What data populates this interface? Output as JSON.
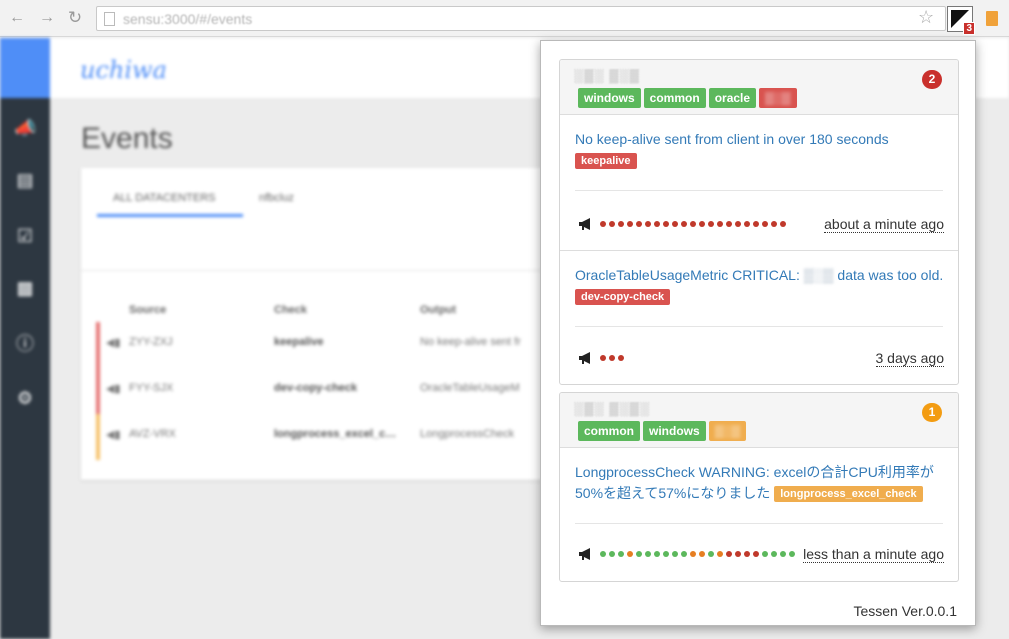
{
  "browser": {
    "url": "sensu:3000/#/events",
    "extension_badge": "3"
  },
  "app": {
    "logo": "uchiwa",
    "page_title": "Events",
    "tabs": [
      "ALL DATACENTERS",
      "nfbcluz"
    ],
    "columns": [
      "Source",
      "Check",
      "Output"
    ],
    "rows": [
      {
        "source": "ZYY-ZXJ",
        "check": "keepalive",
        "output": "No keep-alive sent fr",
        "status_color": "#e57373"
      },
      {
        "source": "FYY-SJX",
        "check": "dev-copy-check",
        "output": "OracleTableUsageM",
        "status_color": "#e57373"
      },
      {
        "source": "AVZ-VRX",
        "check": "longprocess_excel_c…",
        "output": "LongprocessCheck",
        "status_color": "#f6c26b"
      }
    ]
  },
  "popup": {
    "clients": [
      {
        "host": "░▒░ ▒░▒",
        "count": "2",
        "count_color": "#c9302c",
        "tags": [
          {
            "text": "windows",
            "color": "green"
          },
          {
            "text": "common",
            "color": "green"
          },
          {
            "text": "oracle",
            "color": "green"
          },
          {
            "text": "▒░▒",
            "color": "red",
            "blurred": true
          }
        ],
        "events": [
          {
            "output_parts": [
              "No keep-alive sent from client in over 180 seconds "
            ],
            "check": "keepalive",
            "check_color": "red",
            "history": [
              "#c0392b",
              "#c0392b",
              "#c0392b",
              "#c0392b",
              "#c0392b",
              "#c0392b",
              "#c0392b",
              "#c0392b",
              "#c0392b",
              "#c0392b",
              "#c0392b",
              "#c0392b",
              "#c0392b",
              "#c0392b",
              "#c0392b",
              "#c0392b",
              "#c0392b",
              "#c0392b",
              "#c0392b",
              "#c0392b",
              "#c0392b"
            ],
            "ago": "about a minute ago"
          },
          {
            "output_before": "OracleTableUsageMetric CRITICAL: ",
            "output_blur": "▒░▒",
            "output_after": " data was too old. ",
            "check": "dev-copy-check",
            "check_color": "red",
            "history": [
              "#c0392b",
              "#c0392b",
              "#c0392b"
            ],
            "ago": "3 days ago"
          }
        ]
      },
      {
        "host": "░▒░ ▒░▒░",
        "count": "1",
        "count_color": "#f39c12",
        "tags": [
          {
            "text": "common",
            "color": "green"
          },
          {
            "text": "windows",
            "color": "green"
          },
          {
            "text": "▒░▒",
            "color": "orange",
            "blurred": true
          }
        ],
        "events": [
          {
            "output_line1": "LongprocessCheck WARNING: excelの合計CPU利用率が",
            "output_line2": "50%を超えて57%になりました ",
            "check": "longprocess_excel_check",
            "check_color": "orange",
            "history": [
              "#5cb85c",
              "#5cb85c",
              "#5cb85c",
              "#e67e22",
              "#5cb85c",
              "#5cb85c",
              "#5cb85c",
              "#5cb85c",
              "#5cb85c",
              "#5cb85c",
              "#e67e22",
              "#e67e22",
              "#5cb85c",
              "#e67e22",
              "#c0392b",
              "#c0392b",
              "#c0392b",
              "#c0392b",
              "#5cb85c",
              "#5cb85c",
              "#5cb85c",
              "#5cb85c"
            ],
            "ago": "less than a minute ago"
          }
        ]
      }
    ],
    "footer": "Tessen Ver.0.0.1"
  }
}
